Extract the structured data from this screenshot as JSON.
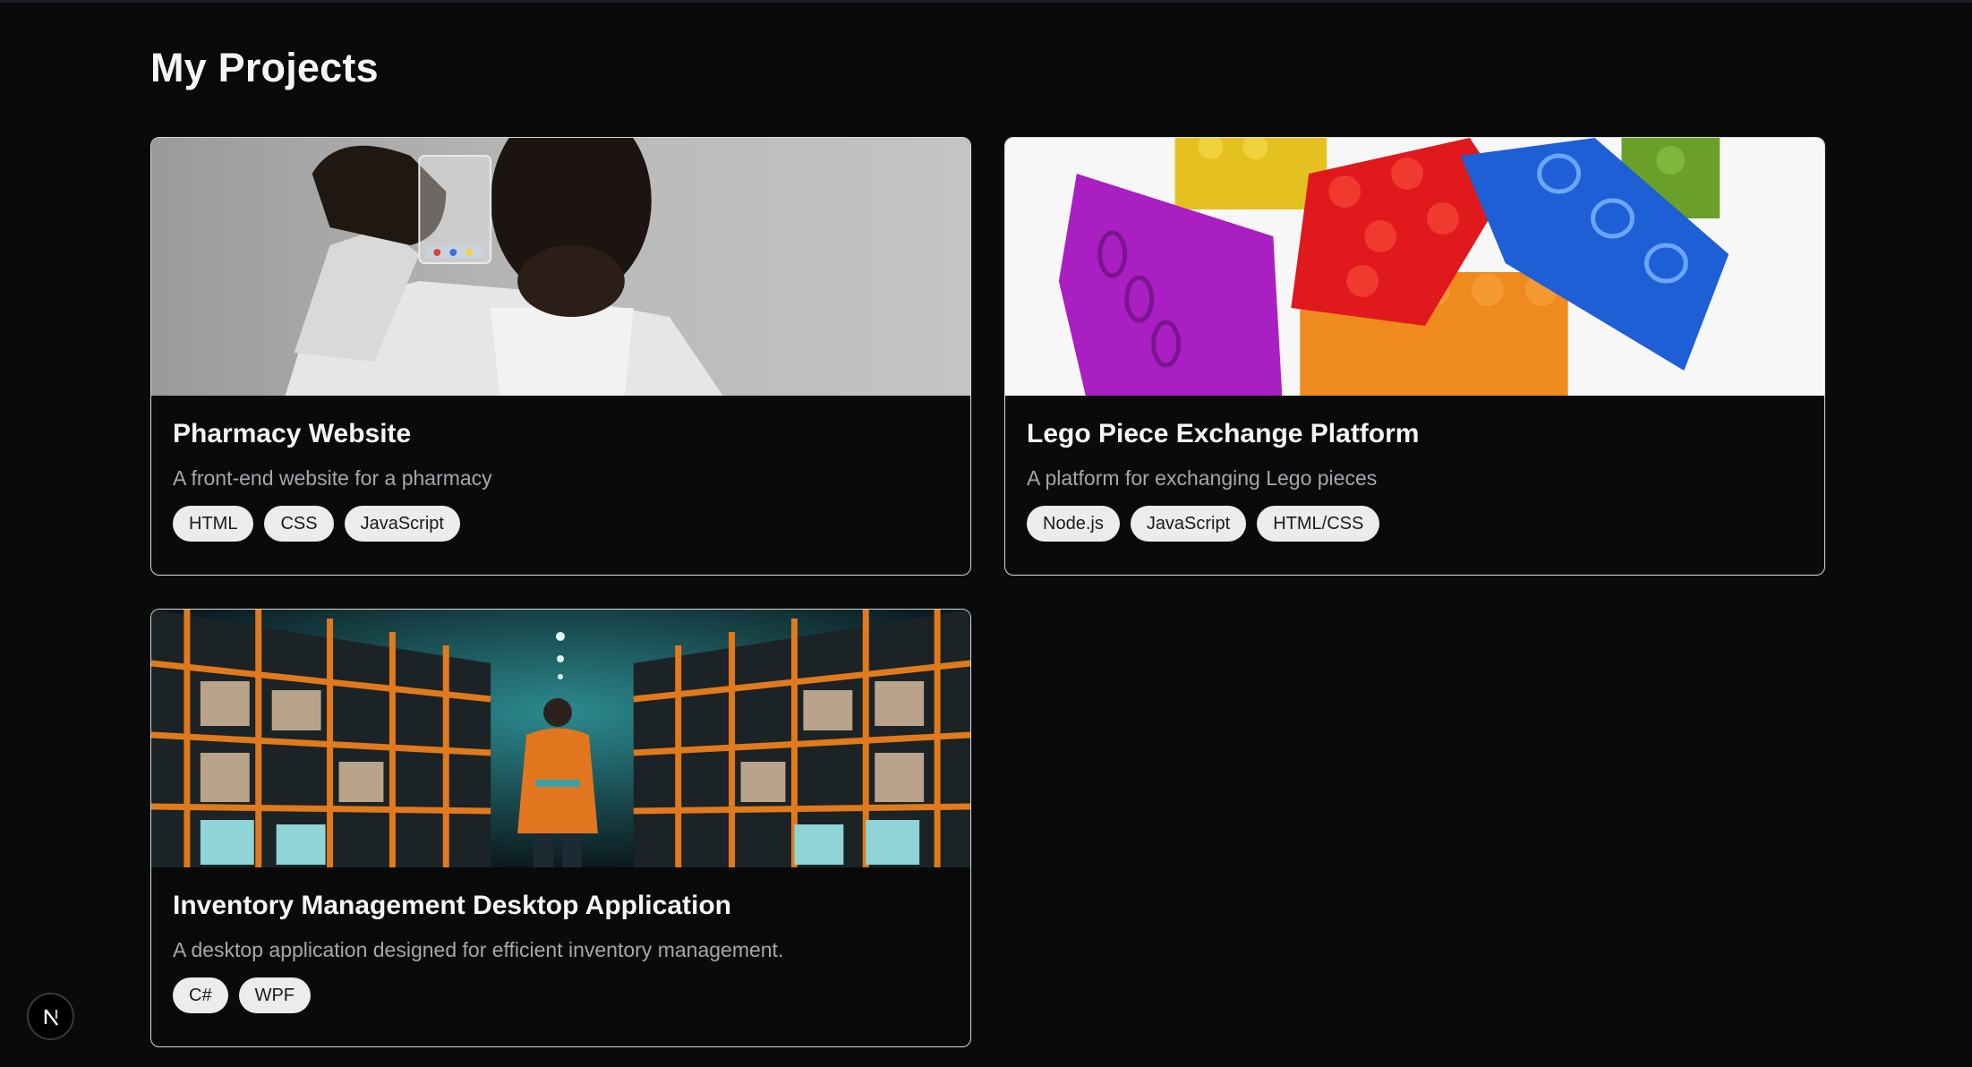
{
  "page": {
    "title": "My Projects"
  },
  "projects": [
    {
      "title": "Pharmacy Website",
      "description": "A front-end website for a pharmacy",
      "image": "pharmacist-holding-beaker-photo",
      "tags": [
        "HTML",
        "CSS",
        "JavaScript"
      ]
    },
    {
      "title": "Lego Piece Exchange Platform",
      "description": "A platform for exchanging Lego pieces",
      "image": "colorful-lego-bricks-photo",
      "tags": [
        "Node.js",
        "JavaScript",
        "HTML/CSS"
      ]
    },
    {
      "title": "Inventory Management Desktop Application",
      "description": "A desktop application designed for efficient inventory management.",
      "image": "warehouse-aisle-worker-photo",
      "tags": [
        "C#",
        "WPF"
      ]
    }
  ],
  "dev_badge": {
    "icon": "nextjs-logo-icon",
    "letter": "N"
  }
}
